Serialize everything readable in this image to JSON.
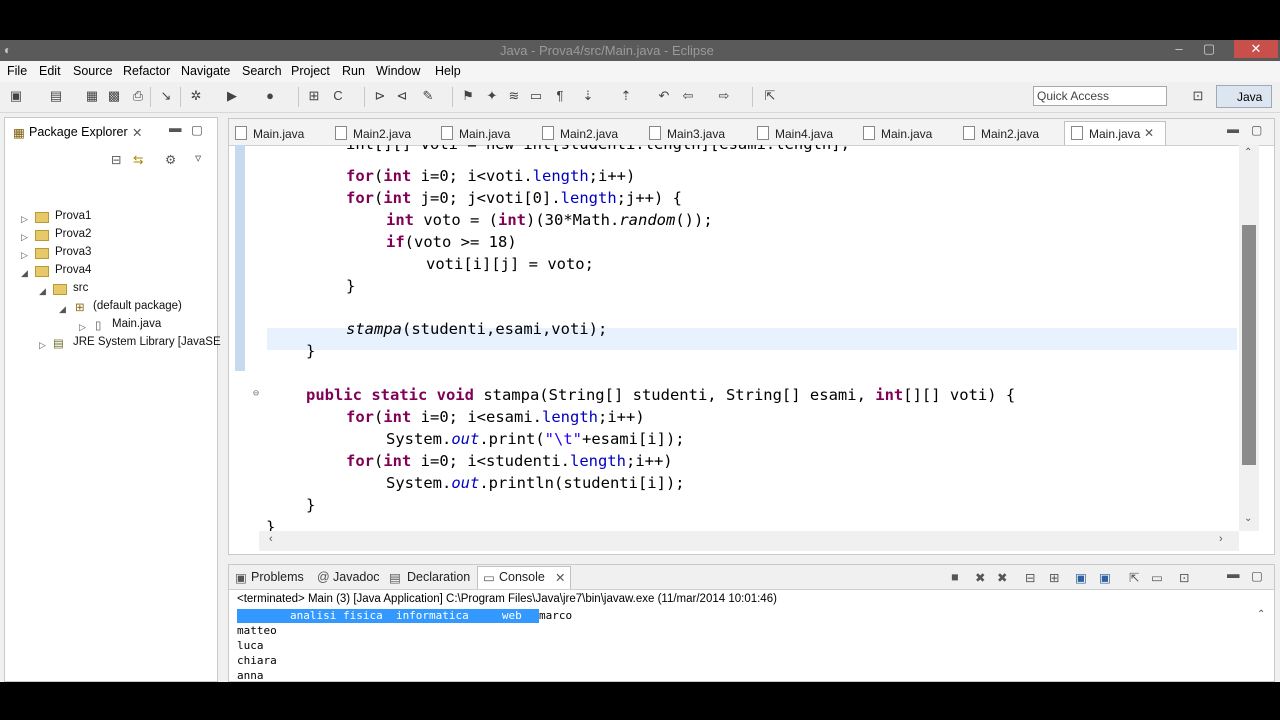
{
  "window": {
    "title": "Java - Prova4/src/Main.java - Eclipse"
  },
  "menu": [
    "File",
    "Edit",
    "Source",
    "Refactor",
    "Navigate",
    "Search",
    "Project",
    "Run",
    "Window",
    "Help"
  ],
  "toolbar": {
    "quick_access_placeholder": "Quick Access",
    "perspective": "Java"
  },
  "package_explorer": {
    "title": "Package Explorer",
    "items": [
      "Prova1",
      "Prova2",
      "Prova3",
      "Prova4",
      "src",
      "(default package)",
      "Main.java",
      "JRE System Library [JavaSE"
    ]
  },
  "editor": {
    "tabs": [
      "Main.java",
      "Main2.java",
      "Main.java",
      "Main2.java",
      "Main3.java",
      "Main4.java",
      "Main.java",
      "Main2.java",
      "Main.java"
    ],
    "active_tab": "Main.java",
    "code": {
      "l0": "int[][] voti = new int[studenti.length][esami.length];",
      "l1_kw": "for",
      "l1_a": "(",
      "l1_kw2": "int",
      "l1_b": " i=0; i<voti.",
      "l1_fld": "length",
      "l1_c": ";i++)",
      "l2_kw": "for",
      "l2_a": "(",
      "l2_kw2": "int",
      "l2_b": " j=0; j<voti[0].",
      "l2_fld": "length",
      "l2_c": ";j++) {",
      "l3_kw": "int",
      "l3_a": " voto = (",
      "l3_kw2": "int",
      "l3_b": ")(30*Math.",
      "l3_it": "random",
      "l3_c": "());",
      "l4_kw": "if",
      "l4_a": "(voto >= 18)",
      "l5": "voti[i][j] = voto;",
      "l6": "}",
      "l7_it": "stampa",
      "l7_a": "(studenti,esami,voti);",
      "l8": "}",
      "l9_kw": "public static void",
      "l9_a": " stampa(String[] studenti, String[] esami, ",
      "l9_kw2": "int",
      "l9_b": "[][] voti) {",
      "l10_kw": "for",
      "l10_a": "(",
      "l10_kw2": "int",
      "l10_b": " i=0; i<esami.",
      "l10_fld": "length",
      "l10_c": ";i++)",
      "l11_a": "System.",
      "l11_it": "out",
      "l11_b": ".print(",
      "l11_str": "\"\\t\"",
      "l11_c": "+esami[i]);",
      "l12_kw": "for",
      "l12_a": "(",
      "l12_kw2": "int",
      "l12_b": " i=0; i<studenti.",
      "l12_fld": "length",
      "l12_c": ";i++)",
      "l13_a": "System.",
      "l13_it": "out",
      "l13_b": ".println(studenti[i]);",
      "l14": "}",
      "l15": "}"
    }
  },
  "console": {
    "tabs": [
      "Problems",
      "Javadoc",
      "Declaration",
      "Console"
    ],
    "status": "<terminated> Main (3) [Java Application] C:\\Program Files\\Java\\jre7\\bin\\javaw.exe (11/mar/2014 10:01:46)",
    "header_line": "        analisi fisica  informatica     web",
    "header_tail": "marco",
    "lines": [
      "matteo",
      "luca",
      "chiara",
      "anna"
    ]
  },
  "colors": {
    "keyword": "#7f0055",
    "field": "#0000c0",
    "string": "#2a00ff",
    "selection": "#3399ff"
  }
}
